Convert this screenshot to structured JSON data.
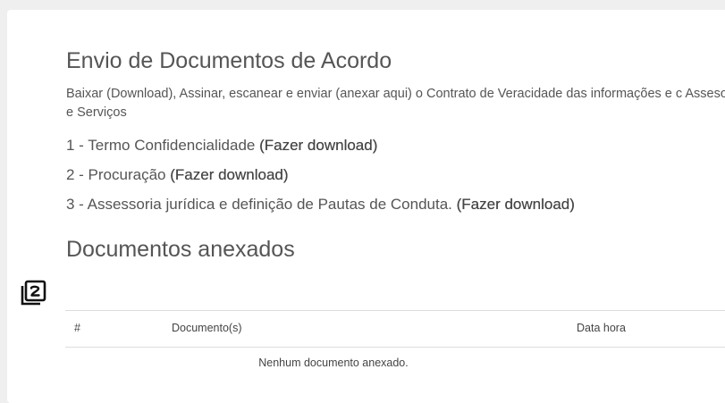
{
  "section": {
    "title": "Envio de Documentos de Acordo",
    "description": "Baixar (Download), Assinar, escanear e enviar (anexar aqui) o Contrato de Veracidade das informações e c Assesoria e Serviços"
  },
  "documents": [
    {
      "prefix": "1 - Termo Confidencialidade ",
      "link": "(Fazer download)"
    },
    {
      "prefix": "2 - Procuração ",
      "link": "(Fazer download)"
    },
    {
      "prefix": "3 - Assessoria jurídica e definição de Pautas de Conduta. ",
      "link": "(Fazer download)"
    }
  ],
  "attached": {
    "title": "Documentos anexados",
    "icon": "filter-2-icon",
    "columns": [
      "#",
      "Documento(s)",
      "Data hora"
    ],
    "empty_message": "Nenhum documento anexado."
  }
}
